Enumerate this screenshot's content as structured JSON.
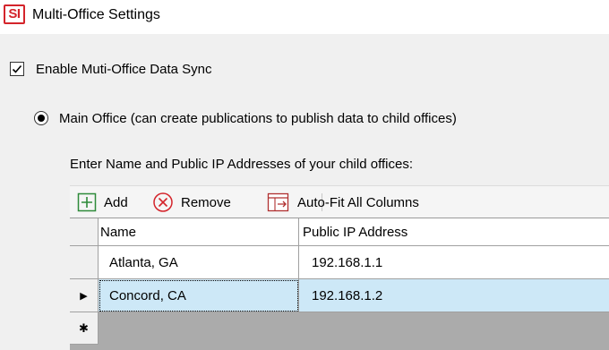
{
  "window": {
    "icon_text": "SI",
    "title": "Multi-Office Settings"
  },
  "sync": {
    "checkbox_label": "Enable Muti-Office Data Sync",
    "checked": true
  },
  "mode": {
    "radio_label": "Main Office (can create publications to publish data to child offices)",
    "selected": true
  },
  "instruction": "Enter Name and Public IP Addresses of your child offices:",
  "toolbar": {
    "add_label": "Add",
    "remove_label": "Remove",
    "autofit_label": "Auto-Fit All Columns"
  },
  "grid": {
    "columns": [
      "Name",
      "Public IP Address"
    ],
    "rows": [
      {
        "name": "Atlanta, GA",
        "ip": "192.168.1.1"
      },
      {
        "name": "Concord, CA",
        "ip": "192.168.1.2"
      }
    ],
    "selected_row": 1,
    "current_row_marker": "▶",
    "new_row_marker": "✱"
  },
  "colors": {
    "brand": "#d4242b",
    "add_icon": "#2e8b3a",
    "remove_icon": "#d4242b",
    "selection": "#cde8f7"
  }
}
